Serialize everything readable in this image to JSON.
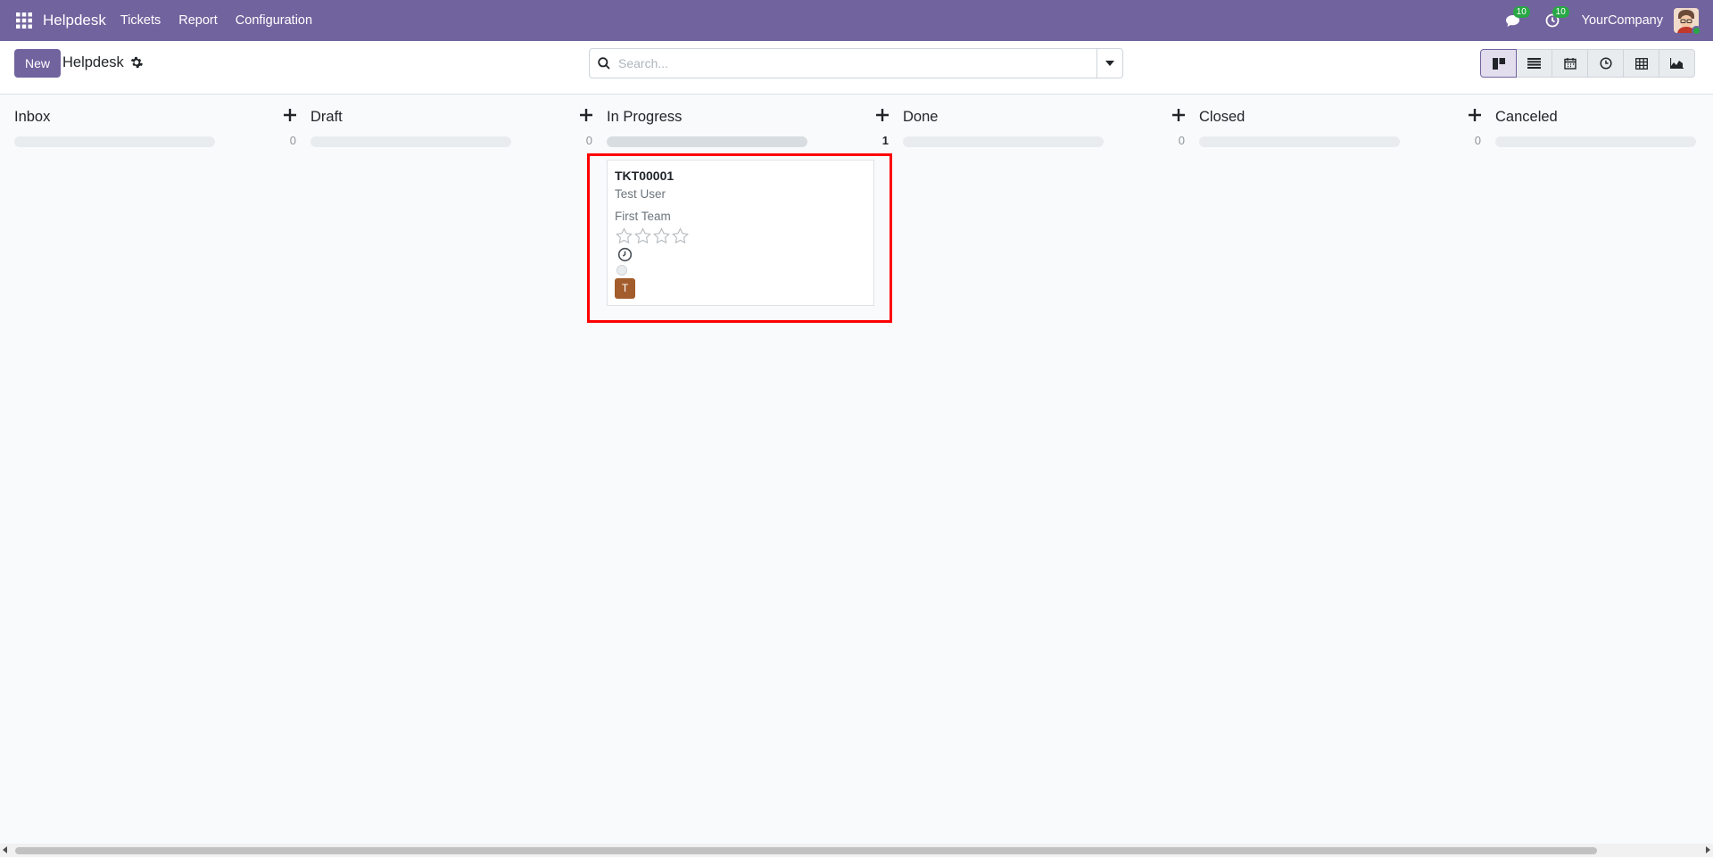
{
  "navbar": {
    "brand": "Helpdesk",
    "menu": [
      "Tickets",
      "Report",
      "Configuration"
    ],
    "messages_badge": "10",
    "activities_badge": "10",
    "company": "YourCompany",
    "bg_color": "#71639e"
  },
  "control_panel": {
    "new_label": "New",
    "breadcrumb": "Helpdesk",
    "search_placeholder": "Search...",
    "views": [
      "kanban",
      "list",
      "calendar",
      "activity",
      "pivot",
      "graph"
    ],
    "active_view": "kanban"
  },
  "kanban": {
    "columns": [
      {
        "title": "Inbox",
        "count": "0"
      },
      {
        "title": "Draft",
        "count": "0"
      },
      {
        "title": "In Progress",
        "count": "1"
      },
      {
        "title": "Done",
        "count": "0"
      },
      {
        "title": "Closed",
        "count": "0"
      },
      {
        "title": "Canceled",
        "count": ""
      }
    ],
    "card": {
      "id": "TKT00001",
      "user": "Test User",
      "team": "First Team",
      "stars": 0,
      "assignee_initial": "T",
      "assignee_color": "#a35d2c"
    }
  },
  "colors": {
    "highlight": "#ff0000",
    "accent": "#71639e"
  }
}
